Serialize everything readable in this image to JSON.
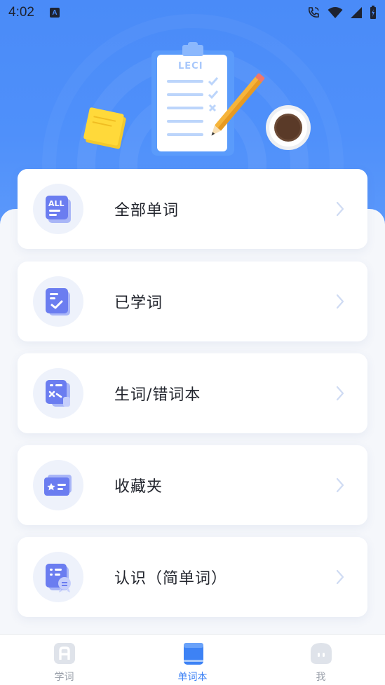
{
  "status_bar": {
    "time": "4:02",
    "indicator": "A"
  },
  "hero": {
    "clipboard_title": "LECI"
  },
  "menu": [
    {
      "label": "全部单词",
      "icon": "all-words-icon",
      "icon_text": "ALL"
    },
    {
      "label": "已学词",
      "icon": "learned-words-icon"
    },
    {
      "label": "生词/错词本",
      "icon": "wrong-words-icon"
    },
    {
      "label": "收藏夹",
      "icon": "favorites-icon"
    },
    {
      "label": "认识（简单词）",
      "icon": "known-words-icon"
    }
  ],
  "tabbar": {
    "tabs": [
      {
        "label": "学词",
        "icon": "learn-icon",
        "active": false
      },
      {
        "label": "单词本",
        "icon": "wordbook-icon",
        "active": true
      },
      {
        "label": "我",
        "icon": "profile-icon",
        "active": false
      }
    ]
  },
  "colors": {
    "primary": "#4a8bf8",
    "active_tab": "#3d82f5",
    "inactive_tab": "#9aa0aa",
    "icon_purple": "#6b7df0"
  }
}
